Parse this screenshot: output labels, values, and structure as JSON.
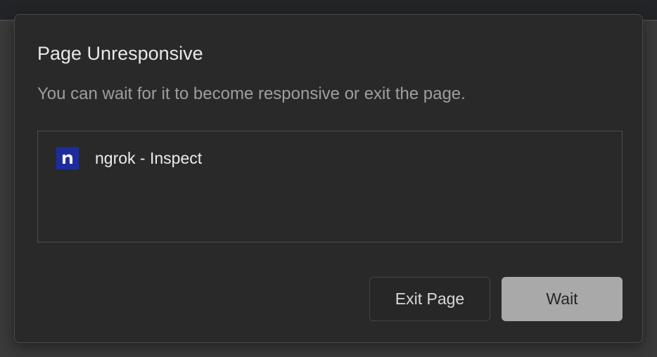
{
  "dialog": {
    "title": "Page Unresponsive",
    "message": "You can wait for it to become responsive or exit the page."
  },
  "pages": [
    {
      "title": "ngrok - Inspect",
      "favicon_icon": "ngrok-n-icon",
      "favicon_color": "#1e2b9e"
    }
  ],
  "buttons": {
    "exit_label": "Exit Page",
    "wait_label": "Wait"
  },
  "colors": {
    "dialog_bg": "#292929",
    "primary_button_bg": "#a9a9a9"
  }
}
